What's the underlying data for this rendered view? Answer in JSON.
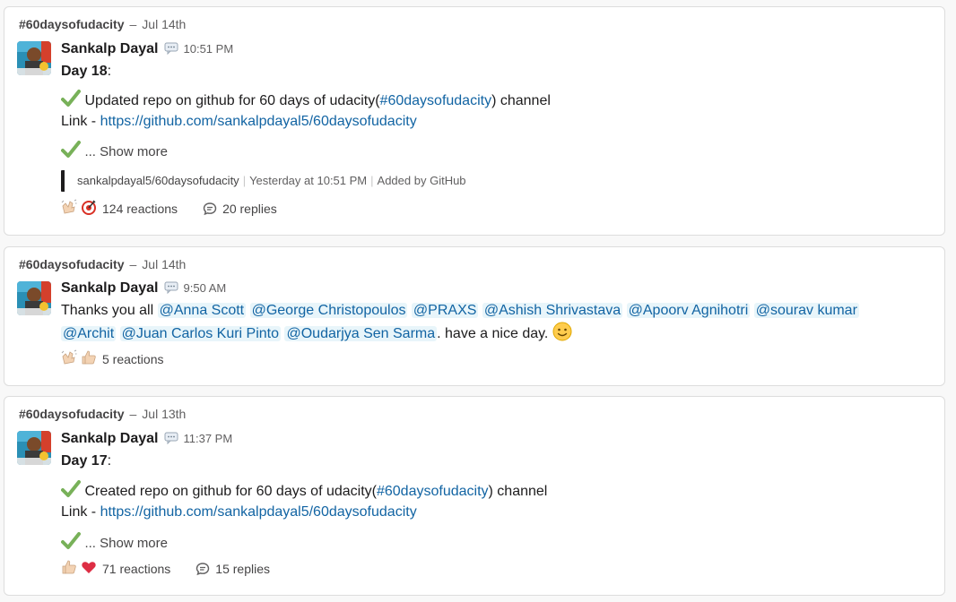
{
  "messages": [
    {
      "channel": "#60daysofudacity",
      "date": "Jul 14th",
      "author": "Sankalp Dayal",
      "time": "10:51 PM",
      "day_label": "Day 18",
      "day_suffix": ":",
      "line1_text": " Updated repo on github for 60 days of udacity(",
      "line1_channel": "#60daysofudacity",
      "line1_end": ")  channel",
      "link_prefix": "Link - ",
      "link_url": "https://github.com/sankalpdayal5/60daysofudacity",
      "show_more": "... Show more",
      "unfurl_repo": "sankalpdayal5/60daysofudacity",
      "unfurl_time": "Yesterday at 10:51 PM",
      "unfurl_added": "Added by GitHub",
      "reactions_label": "124 reactions",
      "replies_label": "20 replies"
    },
    {
      "channel": "#60daysofudacity",
      "date": "Jul 14th",
      "author": "Sankalp Dayal",
      "time": "9:50 AM",
      "thanks_prefix": "Thanks you all ",
      "mentions_line1": [
        "@Anna Scott",
        "@George Christopoulos",
        "@PRAXS",
        "@Ashish Shrivastava",
        "@Apoorv Agnihotri",
        "@sourav kumar"
      ],
      "mentions_line2": [
        "@Archit",
        "@Juan Carlos Kuri Pinto",
        "@Oudarjya Sen Sarma"
      ],
      "thanks_suffix": ". have a nice day. ",
      "reactions_label": "5 reactions"
    },
    {
      "channel": "#60daysofudacity",
      "date": "Jul 13th",
      "author": "Sankalp Dayal",
      "time": "11:37 PM",
      "day_label": "Day 17",
      "day_suffix": ":",
      "line1_text": " Created repo on github for 60 days of udacity(",
      "line1_channel": "#60daysofudacity",
      "line1_end": ")  channel",
      "link_prefix": "Link - ",
      "link_url": "https://github.com/sankalpdayal5/60daysofudacity",
      "show_more": "... Show more",
      "reactions_label": "71 reactions",
      "replies_label": "15 replies"
    }
  ],
  "colors": {
    "link": "#1264a3",
    "mention_bg": "#e8f5fa",
    "check": "#78b159",
    "muted": "#616061"
  },
  "icons": [
    "status-speech-icon",
    "check-mark-icon",
    "clapping-hands-icon",
    "target-icon",
    "thumbs-up-icon",
    "red-heart-icon",
    "smiley-icon",
    "replies-icon"
  ]
}
